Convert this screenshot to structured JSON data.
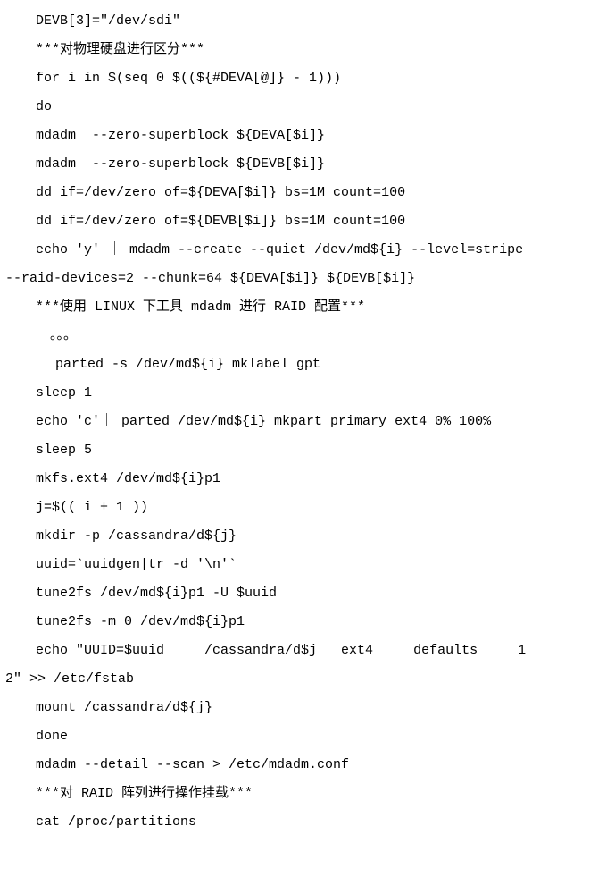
{
  "lines": [
    {
      "cls": "ind1",
      "text": "DEVB[3]=\"/dev/sdi\""
    },
    {
      "cls": "ind1",
      "text": "***对物理硬盘进行区分***"
    },
    {
      "cls": "ind1",
      "text": "for i in $(seq 0 $((${#DEVA[@]} - 1)))"
    },
    {
      "cls": "ind1",
      "text": "do"
    },
    {
      "cls": "ind1",
      "text": "mdadm  --zero-superblock ${DEVA[$i]}"
    },
    {
      "cls": "ind1",
      "text": "mdadm  --zero-superblock ${DEVB[$i]}"
    },
    {
      "cls": "ind1",
      "text": "dd if=/dev/zero of=${DEVA[$i]} bs=1M count=100"
    },
    {
      "cls": "ind1",
      "text": "dd if=/dev/zero of=${DEVB[$i]} bs=1M count=100"
    },
    {
      "cls": "ind1",
      "text": "echo 'y' ｜ mdadm --create --quiet /dev/md${i} --level=stripe"
    },
    {
      "cls": "ind0",
      "text": "--raid-devices=2 --chunk=64 ${DEVA[$i]} ${DEVB[$i]}"
    },
    {
      "cls": "ind1",
      "text": "***使用 LINUX 下工具 mdadm 进行 RAID 配置***"
    },
    {
      "cls": "ind2",
      "text": "。。。"
    },
    {
      "cls": "ind3",
      "text": "parted -s /dev/md${i} mklabel gpt"
    },
    {
      "cls": "ind1",
      "text": "sleep 1"
    },
    {
      "cls": "ind1",
      "text": "echo 'c'｜ parted /dev/md${i} mkpart primary ext4 0% 100%"
    },
    {
      "cls": "ind1",
      "text": "sleep 5"
    },
    {
      "cls": "ind1",
      "text": "mkfs.ext4 /dev/md${i}p1"
    },
    {
      "cls": "ind1",
      "text": "j=$(( i + 1 ))"
    },
    {
      "cls": "ind1",
      "text": "mkdir -p /cassandra/d${j}"
    },
    {
      "cls": "ind1",
      "text": "uuid=`uuidgen|tr -d '\\n'`"
    },
    {
      "cls": "ind1",
      "text": "tune2fs /dev/md${i}p1 -U $uuid"
    },
    {
      "cls": "ind1",
      "text": "tune2fs -m 0 /dev/md${i}p1"
    },
    {
      "cls": "ind1",
      "text": "echo \"UUID=$uuid     /cassandra/d$j   ext4     defaults     1"
    },
    {
      "cls": "ind0",
      "text": "2\" >> /etc/fstab"
    },
    {
      "cls": "ind1",
      "text": "mount /cassandra/d${j}"
    },
    {
      "cls": "ind1",
      "text": "done"
    },
    {
      "cls": "ind1",
      "text": "mdadm --detail --scan > /etc/mdadm.conf"
    },
    {
      "cls": "ind1",
      "text": "***对 RAID 阵列进行操作挂载***"
    },
    {
      "cls": "ind1",
      "text": "cat /proc/partitions"
    }
  ]
}
